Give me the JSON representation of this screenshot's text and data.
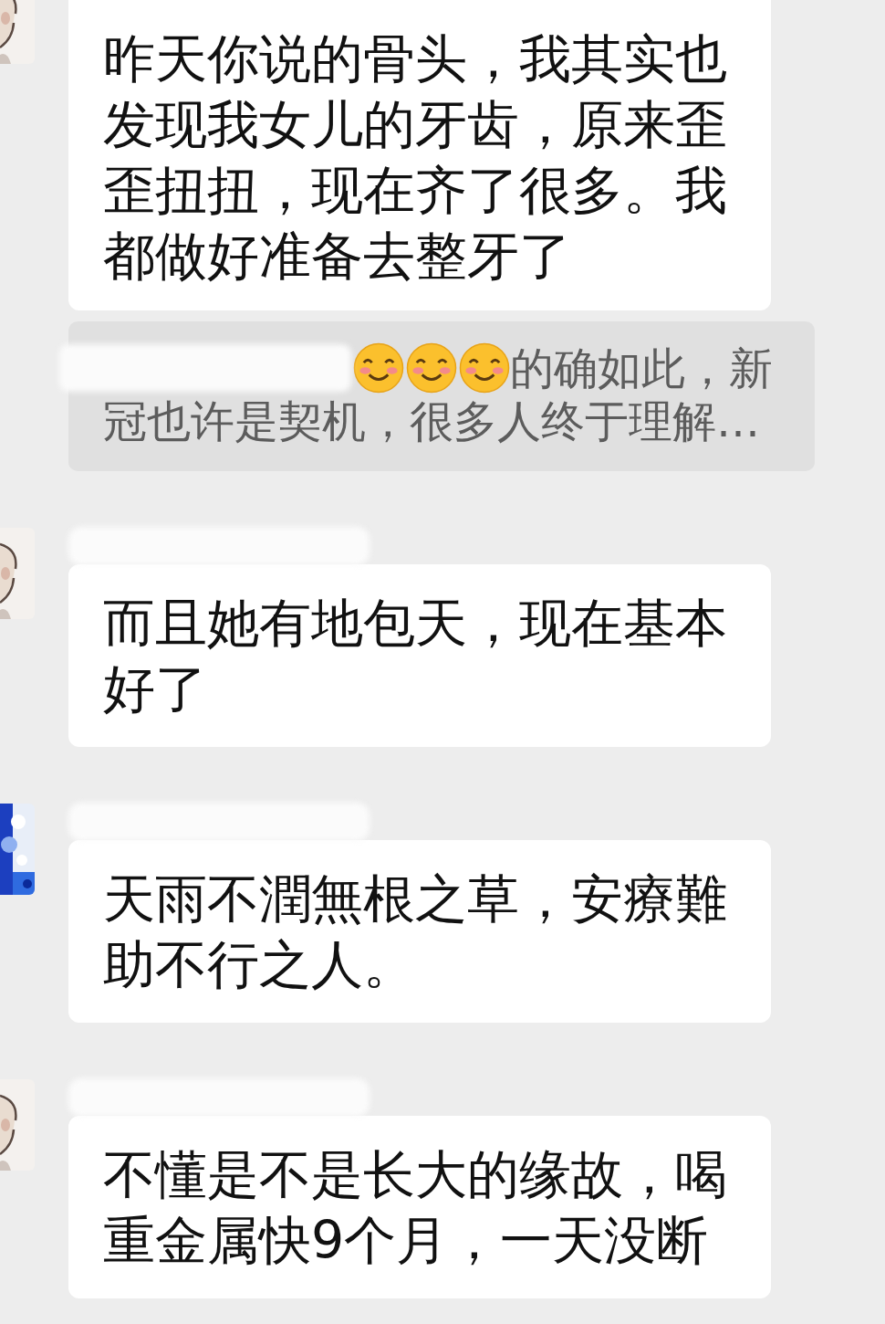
{
  "messages": [
    {
      "kind": "text",
      "text": "昨天你说的骨头，我其实也发现我女儿的牙齿，原来歪歪扭扭，现在齐了很多。我都做好准备去整牙了"
    },
    {
      "kind": "quote",
      "lines": [
        "的确如此，新",
        "冠也许是契机，很多人终于理解…"
      ]
    },
    {
      "kind": "text",
      "text": "而且她有地包天，现在基本好了"
    },
    {
      "kind": "text",
      "text": "天雨不潤無根之草，安療難助不行之人。"
    },
    {
      "kind": "text",
      "text": "不懂是不是长大的缘故，喝重金属快9个月，一天没断"
    }
  ]
}
